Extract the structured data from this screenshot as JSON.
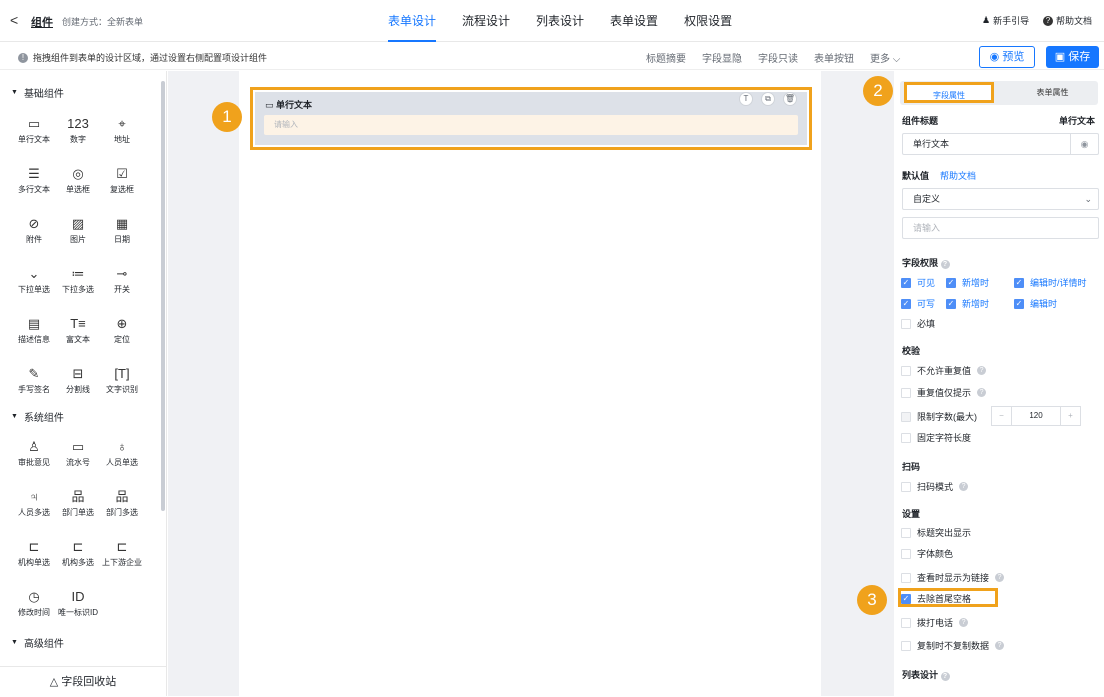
{
  "header": {
    "back": "<",
    "title": "组件",
    "create_mode": "创建方式：全新表单",
    "tabs": [
      "表单设计",
      "流程设计",
      "列表设计",
      "表单设置",
      "权限设置"
    ],
    "guide": "新手引导",
    "help": "帮助文档"
  },
  "toolbar": {
    "tip": "拖拽组件到表单的设计区域，通过设置右侧配置项设计组件",
    "tools": [
      "标题摘要",
      "字段显隐",
      "字段只读",
      "表单按钮",
      "更多 ⌵"
    ],
    "preview": "预览",
    "save": "保存"
  },
  "left": {
    "groups": [
      "基础组件",
      "系统组件",
      "高级组件"
    ],
    "basic": [
      {
        "icon": "▭",
        "label": "单行文本"
      },
      {
        "icon": "123",
        "label": "数字"
      },
      {
        "icon": "⌖",
        "label": "地址"
      },
      {
        "icon": "☰",
        "label": "多行文本"
      },
      {
        "icon": "◎",
        "label": "单选框"
      },
      {
        "icon": "☑",
        "label": "复选框"
      },
      {
        "icon": "⊘",
        "label": "附件"
      },
      {
        "icon": "▨",
        "label": "图片"
      },
      {
        "icon": "▦",
        "label": "日期"
      },
      {
        "icon": "⌄",
        "label": "下拉单选"
      },
      {
        "icon": "≔",
        "label": "下拉多选"
      },
      {
        "icon": "⊸",
        "label": "开关"
      },
      {
        "icon": "▤",
        "label": "描述信息"
      },
      {
        "icon": "T≡",
        "label": "富文本"
      },
      {
        "icon": "⊕",
        "label": "定位"
      },
      {
        "icon": "✎",
        "label": "手写签名"
      },
      {
        "icon": "⊟",
        "label": "分割线"
      },
      {
        "icon": "[T]",
        "label": "文字识别"
      }
    ],
    "system": [
      {
        "icon": "♙",
        "label": "审批意见"
      },
      {
        "icon": "▭",
        "label": "流水号"
      },
      {
        "icon": "♁",
        "label": "人员单选"
      },
      {
        "icon": "♃",
        "label": "人员多选"
      },
      {
        "icon": "品",
        "label": "部门单选"
      },
      {
        "icon": "品",
        "label": "部门多选"
      },
      {
        "icon": "⊏",
        "label": "机构单选"
      },
      {
        "icon": "⊏",
        "label": "机构多选"
      },
      {
        "icon": "⊏",
        "label": "上下游企业"
      },
      {
        "icon": "◷",
        "label": "修改时间"
      },
      {
        "icon": "ID",
        "label": "唯一标识ID"
      }
    ],
    "recycle": "△ 字段回收站"
  },
  "canvas": {
    "field_label": "单行文本",
    "field_placeholder": "请输入",
    "badges": [
      "1",
      "2",
      "3"
    ]
  },
  "panel": {
    "tabs": [
      "字段属性",
      "表单属性"
    ],
    "title_label": "组件标题",
    "title_value": "单行文本",
    "title_input": "单行文本",
    "default_label": "默认值",
    "help_doc": "帮助文档",
    "default_select": "自定义",
    "default_input": "请输入",
    "perm_label": "字段权限",
    "perms": [
      "可见",
      "新增时",
      "编辑时/详情时",
      "可写",
      "新增时",
      "编辑时",
      "必填"
    ],
    "verify_label": "校验",
    "verify": [
      "不允许重复值",
      "重复值仅提示",
      "限制字数(最大)",
      "固定字符长度"
    ],
    "limit": {
      "minus": "−",
      "value": "120",
      "plus": "+"
    },
    "scan_label": "扫码",
    "scan": [
      "扫码模式"
    ],
    "setting_label": "设置",
    "settings": [
      "标题突出显示",
      "字体颜色",
      "查看时显示为链接",
      "去除首尾空格",
      "拨打电话",
      "复制时不复制数据"
    ],
    "list_label": "列表设计"
  }
}
